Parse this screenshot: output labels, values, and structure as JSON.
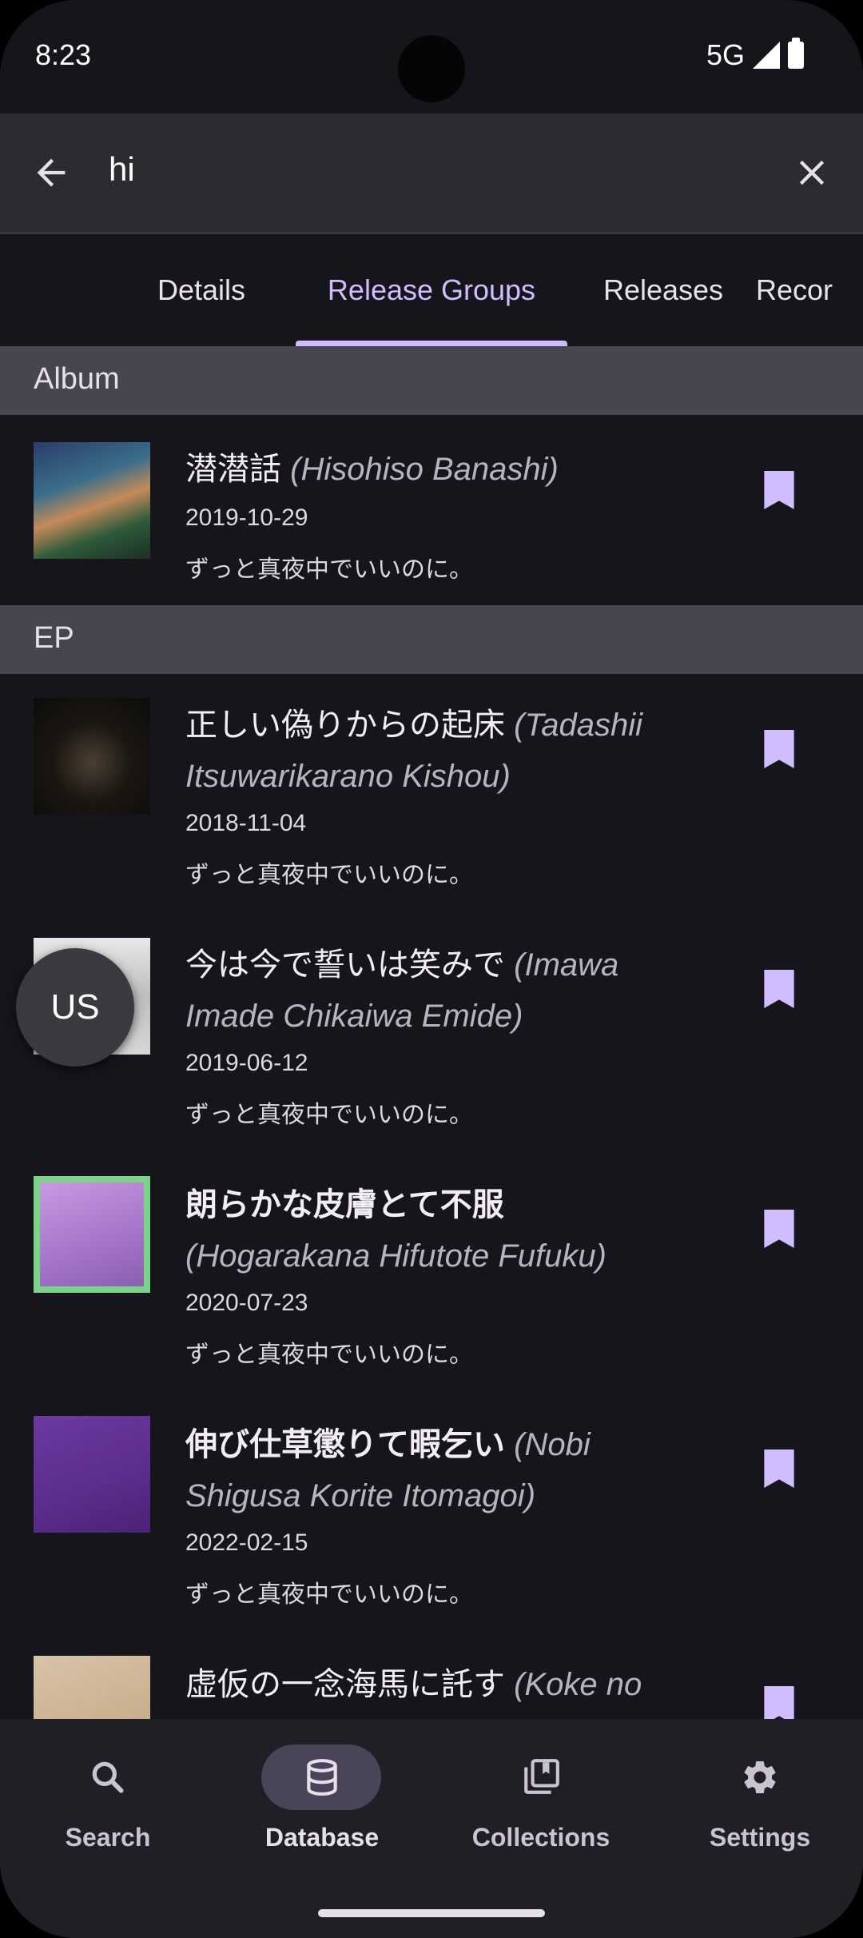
{
  "status": {
    "time": "8:23",
    "network": "5G"
  },
  "search": {
    "query": "hi"
  },
  "tabs": [
    {
      "label": "Details"
    },
    {
      "label": "Release Groups"
    },
    {
      "label": "Releases"
    },
    {
      "label": "Recor"
    }
  ],
  "sections": [
    {
      "label": "Album"
    },
    {
      "label": "EP"
    }
  ],
  "items": [
    {
      "jp": "潜潜話",
      "romaji_pre": "(",
      "romaji": "Hisohiso Banashi",
      "romaji_post": ")",
      "date": "2019-10-29",
      "artist": "ずっと真夜中でいいのに。"
    },
    {
      "jp": "正しい偽りからの起床",
      "romaji_pre": "(",
      "romaji": "Tadashii Itsuwarikarano Kishou",
      "romaji_post": ")",
      "date": "2018-11-04",
      "artist": "ずっと真夜中でいいのに。"
    },
    {
      "jp": "今は今で誓いは笑みで",
      "romaji_pre": "(",
      "romaji": "Imawa Imade Chikaiwa Emide",
      "romaji_post": ")",
      "date": "2019-06-12",
      "artist": "ずっと真夜中でいいのに。"
    },
    {
      "jp": "朗らかな皮膚とて不服",
      "romaji_pre": "(",
      "romaji": "Hogarakana Hifutote Fufuku",
      "romaji_post": ")",
      "date": "2020-07-23",
      "artist": "ずっと真夜中でいいのに。"
    },
    {
      "jp": "伸び仕草懲りて暇乞い",
      "romaji_pre": "(",
      "romaji": "Nobi Shigusa Korite Itomagoi",
      "romaji_post": ")",
      "date": "2022-02-15",
      "artist": "ずっと真夜中でいいのに。"
    },
    {
      "jp": "虚仮の一念海馬に託す",
      "romaji_pre": "(",
      "romaji": "Koke no",
      "romaji_post": "",
      "date": "",
      "artist": ""
    }
  ],
  "fab": {
    "label": "US"
  },
  "nav": [
    {
      "label": "Search",
      "icon": "search-icon"
    },
    {
      "label": "Database",
      "icon": "database-icon"
    },
    {
      "label": "Collections",
      "icon": "collections-icon"
    },
    {
      "label": "Settings",
      "icon": "settings-icon"
    }
  ],
  "colors": {
    "accent": "#cfbdfe",
    "background": "#16151c",
    "section": "#47464e",
    "bookmark": "#cfbdfe"
  }
}
